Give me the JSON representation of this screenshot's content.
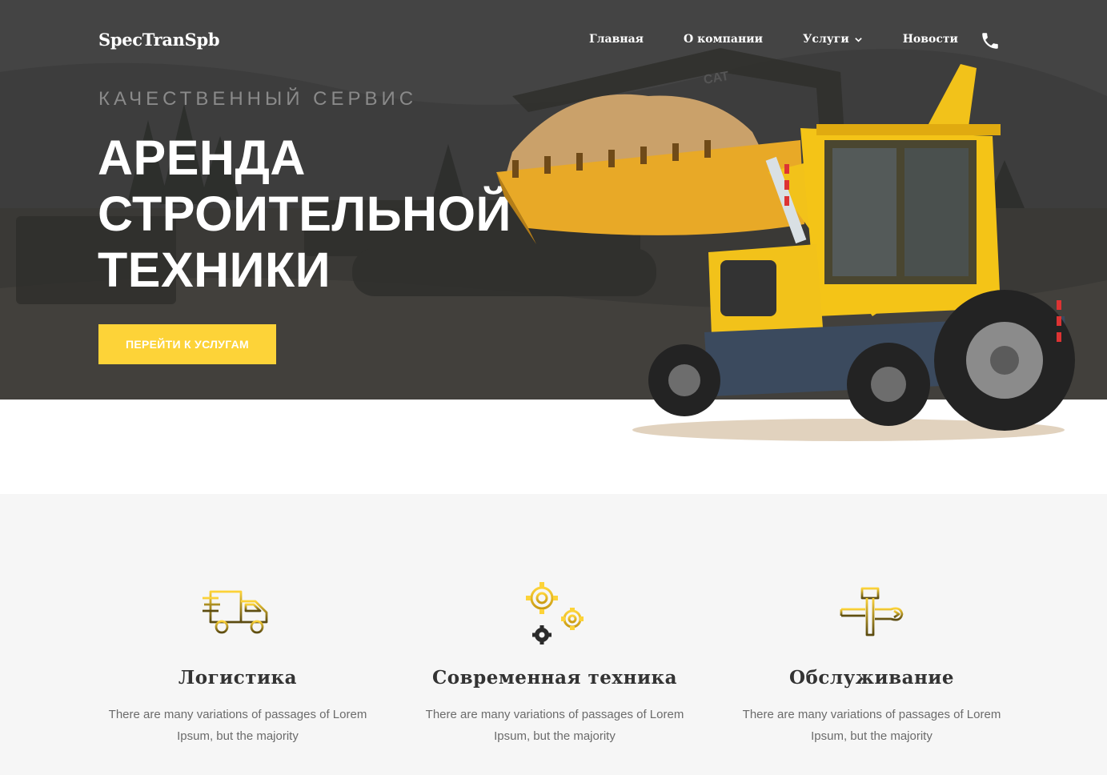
{
  "header": {
    "logo": "SpecTranSpb",
    "nav": [
      {
        "label": "Главная"
      },
      {
        "label": "О компании"
      },
      {
        "label": "Услуги",
        "has_dropdown": true
      },
      {
        "label": "Новости"
      }
    ],
    "phone_icon": "phone-icon"
  },
  "hero": {
    "kicker": "КАЧЕСТВЕННЫЙ СЕРВИС",
    "headline_lines": [
      "АРЕНДА",
      "СТРОИТЕЛЬНОЙ",
      "ТЕХНИКИ"
    ],
    "cta_label": "ПЕРЕЙТИ К УСЛУГАМ",
    "image": "yellow-backhoe-loader"
  },
  "features": [
    {
      "icon": "truck-icon",
      "title": "Логистика",
      "text": "There are many variations of passages of Lorem Ipsum, but the majority"
    },
    {
      "icon": "gears-icon",
      "title": "Современная техника",
      "text": "There are many variations of passages of Lorem Ipsum, but the majority"
    },
    {
      "icon": "tools-icon",
      "title": "Обслуживание",
      "text": "There are many variations of passages of Lorem Ipsum, but the majority"
    }
  ],
  "colors": {
    "accent": "#fdd338",
    "hero_overlay": "#3c3c3c",
    "features_bg": "#f6f6f6",
    "heading": "#333333",
    "body_text": "#6b6b6b"
  }
}
